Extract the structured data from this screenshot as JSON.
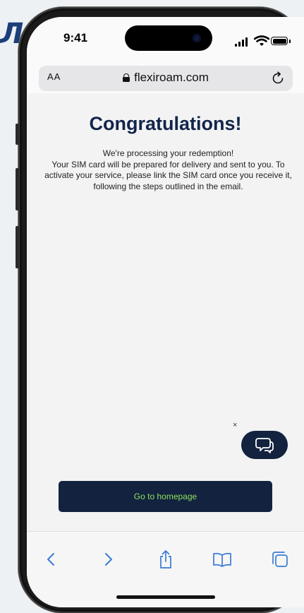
{
  "status": {
    "time": "9:41"
  },
  "browser": {
    "text_size_label": "AA",
    "url": "flexiroam.com",
    "icons": {
      "lock": "lock-icon",
      "reload": "reload-icon"
    }
  },
  "page": {
    "title": "Congratulations!",
    "message_lines": [
      "We're processing your redemption!",
      "Your SIM card will be prepared for delivery and sent to you. To activate your service, please link the SIM card once you receive it, following the steps outlined in the email."
    ],
    "chat_close_label": "×",
    "cta_label": "Go to homepage",
    "colors": {
      "navy": "#12223f",
      "cta_text": "#8fe05d"
    }
  },
  "toolbar": {
    "icons": [
      "back-icon",
      "forward-icon",
      "share-icon",
      "bookmarks-icon",
      "tabs-icon"
    ]
  }
}
